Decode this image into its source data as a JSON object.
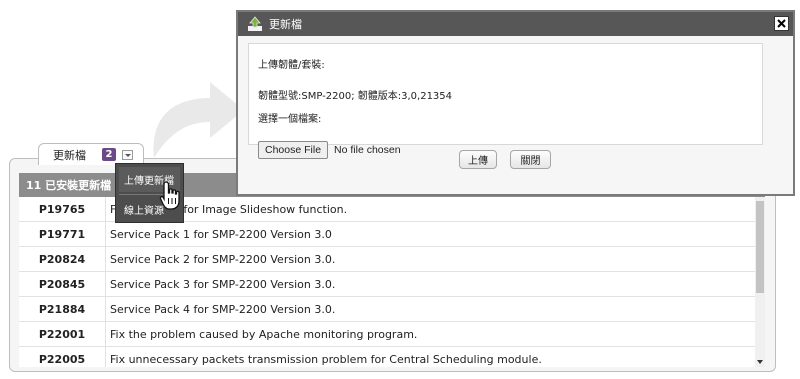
{
  "updates_panel": {
    "tab_label": "更新檔",
    "tab_badge": "2",
    "header": "11 已安裝更新檔",
    "rows": [
      {
        "code": "P19765",
        "desc": "Fix problems for Image Slideshow function."
      },
      {
        "code": "P19771",
        "desc": "Service Pack 1 for SMP-2200 Version 3.0"
      },
      {
        "code": "P20824",
        "desc": "Service Pack 2 for SMP-2200 Version 3.0."
      },
      {
        "code": "P20845",
        "desc": "Service Pack 3 for SMP-2200 Version 3.0."
      },
      {
        "code": "P21884",
        "desc": "Service Pack 4 for SMP-2200 Version 3.0."
      },
      {
        "code": "P22001",
        "desc": "Fix the problem caused by Apache monitoring program."
      },
      {
        "code": "P22005",
        "desc": "Fix unnecessary packets transmission problem for Central Scheduling module."
      }
    ]
  },
  "context_menu": {
    "items": [
      "上傳更新檔",
      "線上資源"
    ]
  },
  "dialog": {
    "title": "更新檔",
    "heading": "上傳韌體/套裝:",
    "firmware_info": "韌體型號:SMP-2200; 韌體版本:3,0,21354",
    "select_prompt": "選擇一個檔案:",
    "choose_file_label": "Choose File",
    "no_file_text": "No file chosen",
    "upload_button": "上傳",
    "close_button": "關閉"
  },
  "colors": {
    "dialog_titlebar": "#575757",
    "panel_header": "#8c8c8c",
    "badge": "#6b4a85",
    "menu_bg": "#4d4d4d"
  }
}
